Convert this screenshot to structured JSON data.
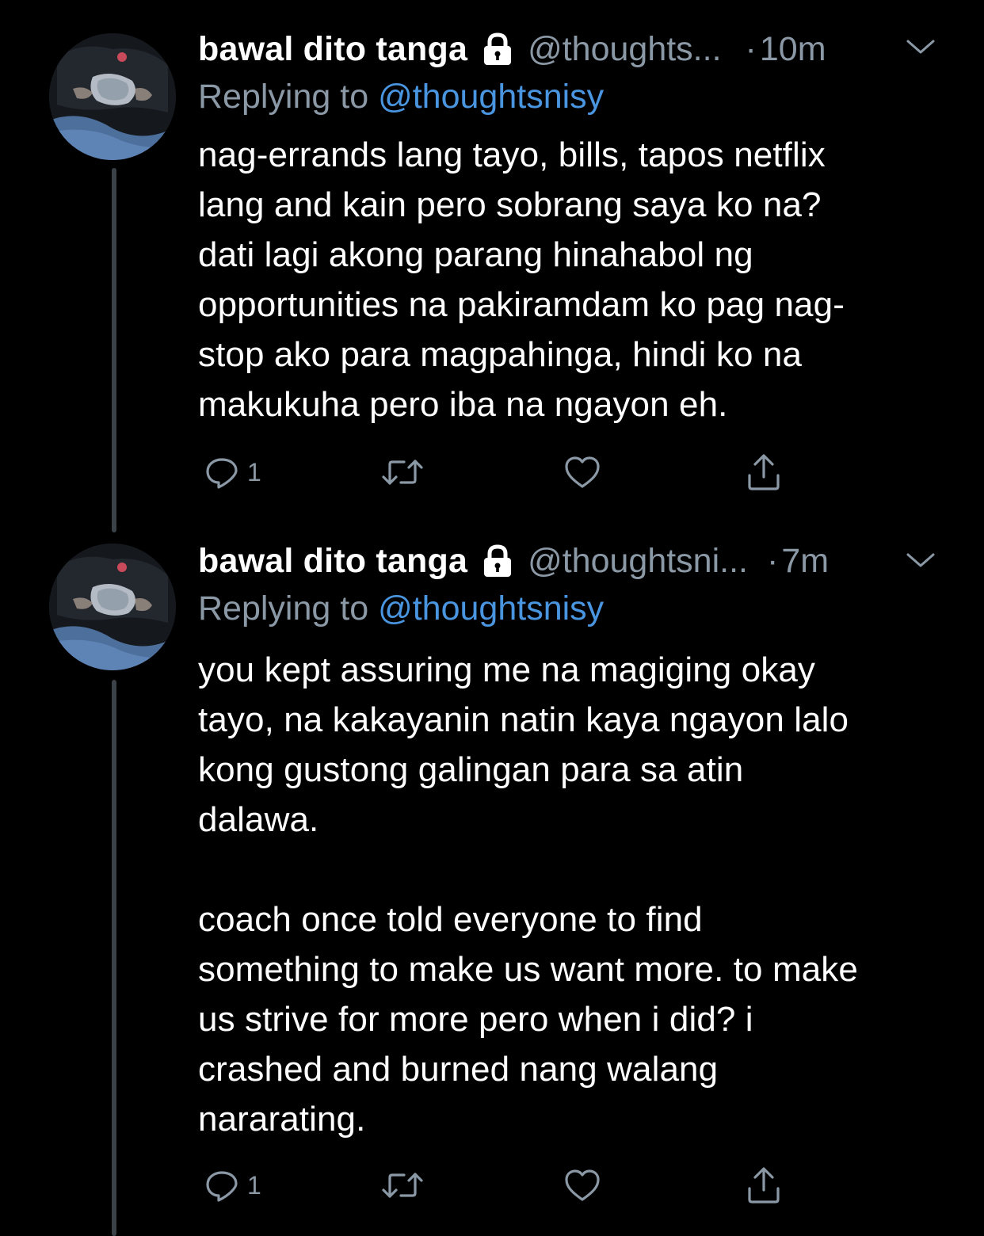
{
  "tweets": [
    {
      "author_name": "bawal dito tanga",
      "handle": "@thoughts...",
      "time": "10m",
      "replying_label": "Replying to ",
      "replying_to": "@thoughtsnisy",
      "text": "nag-errands lang tayo, bills, tapos netflix\nlang and kain pero sobrang saya ko na?\ndati lagi akong parang hinahabol ng\nopportunities na pakiramdam ko pag nag-\nstop ako para magpahinga, hindi ko na\nmakukuha pero iba na ngayon eh.",
      "reply_count": "1"
    },
    {
      "author_name": "bawal dito tanga",
      "handle": "@thoughtsni...",
      "time": "7m",
      "replying_label": "Replying to ",
      "replying_to": "@thoughtsnisy",
      "text": "you kept assuring me na magiging okay\ntayo, na kakayanin natin kaya ngayon lalo\nkong gustong galingan para sa atin\ndalawa.\n\ncoach once told everyone to find\nsomething to make us want more. to make\nus strive for more pero when i did? i\ncrashed and burned nang walang\nnararating.",
      "reply_count": "1"
    }
  ],
  "separator": "·",
  "icons": {
    "protected": "lock-icon",
    "menu": "chevron-down-icon",
    "reply": "reply-icon",
    "retweet": "retweet-icon",
    "like": "heart-icon",
    "share": "share-icon"
  },
  "colors": {
    "background": "#000000",
    "text": "#ffffff",
    "secondary": "#8b98a5",
    "link": "#4a95e0",
    "thread_line": "#3d4248"
  }
}
